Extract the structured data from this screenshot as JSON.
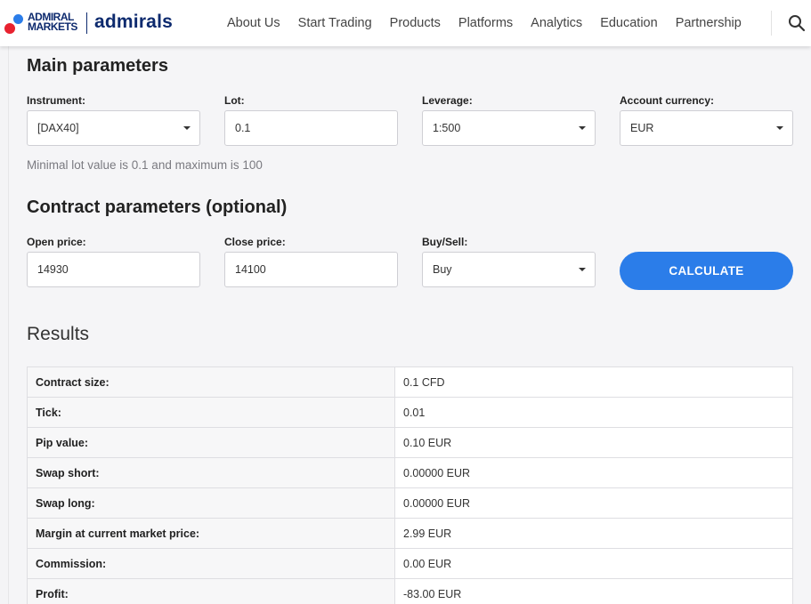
{
  "header": {
    "logo_line1": "ADMIRAL",
    "logo_line2": "MARKETS",
    "logo_brand": "admirals",
    "nav": [
      "About Us",
      "Start Trading",
      "Products",
      "Platforms",
      "Analytics",
      "Education",
      "Partnership"
    ],
    "search_icon": "search-icon"
  },
  "main_parameters": {
    "title": "Main parameters",
    "instrument": {
      "label": "Instrument:",
      "value": "[DAX40]"
    },
    "lot": {
      "label": "Lot:",
      "value": "0.1"
    },
    "leverage": {
      "label": "Leverage:",
      "value": "1:500"
    },
    "account_currency": {
      "label": "Account currency:",
      "value": "EUR"
    },
    "hint": "Minimal lot value is 0.1 and maximum is 100"
  },
  "contract_parameters": {
    "title": "Contract parameters (optional)",
    "open_price": {
      "label": "Open price:",
      "value": "14930"
    },
    "close_price": {
      "label": "Close price:",
      "value": "14100"
    },
    "buy_sell": {
      "label": "Buy/Sell:",
      "value": "Buy"
    },
    "calculate_label": "CALCULATE"
  },
  "results": {
    "title": "Results",
    "rows": [
      {
        "key": "Contract size:",
        "value": "0.1 CFD"
      },
      {
        "key": "Tick:",
        "value": "0.01"
      },
      {
        "key": "Pip value:",
        "value": "0.10 EUR"
      },
      {
        "key": "Swap short:",
        "value": "0.00000 EUR"
      },
      {
        "key": "Swap long:",
        "value": "0.00000 EUR"
      },
      {
        "key": "Margin at current market price:",
        "value": "2.99 EUR"
      },
      {
        "key": "Commission:",
        "value": "0.00 EUR"
      },
      {
        "key": "Profit:",
        "value": "-83.00 EUR"
      }
    ]
  },
  "colors": {
    "accent": "#2b7de9",
    "brand_navy": "#0d2a6e",
    "brand_red": "#e8222f"
  }
}
